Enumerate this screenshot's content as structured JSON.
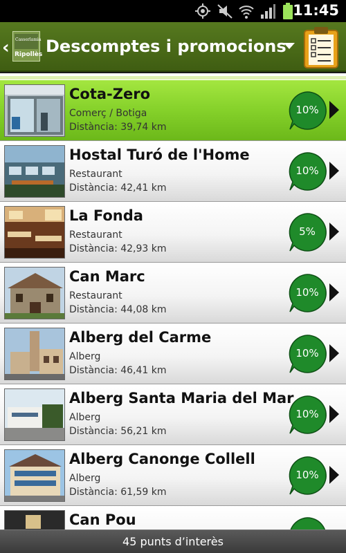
{
  "status_bar": {
    "time": "11:45",
    "icons": [
      "gps-icon",
      "mute-icon",
      "wifi-icon",
      "signal-icon",
      "battery-icon"
    ]
  },
  "action_bar": {
    "logo_text": "Ripollès",
    "logo_mini": "Casserlamia",
    "title": "Descomptes i promocions"
  },
  "items": [
    {
      "name": "Cota-Zero",
      "category": "Comerç / Botiga",
      "distance": "Distància: 39,74 km",
      "discount": "10%",
      "selected": true
    },
    {
      "name": "Hostal Turó de l'Home",
      "category": "Restaurant",
      "distance": "Distància: 42,41 km",
      "discount": "10%"
    },
    {
      "name": "La Fonda",
      "category": "Restaurant",
      "distance": "Distància: 42,93 km",
      "discount": "5%"
    },
    {
      "name": "Can Marc",
      "category": "Restaurant",
      "distance": "Distància: 44,08 km",
      "discount": "10%"
    },
    {
      "name": "Alberg del Carme",
      "category": "Alberg",
      "distance": "Distància: 46,41 km",
      "discount": "10%"
    },
    {
      "name": "Alberg Santa Maria del Mar",
      "category": "Alberg",
      "distance": "Distància: 56,21 km",
      "discount": "10%"
    },
    {
      "name": "Alberg Canonge Collell",
      "category": "Alberg",
      "distance": "Distància: 61,59 km",
      "discount": "10%"
    },
    {
      "name": "Can Pou",
      "category": "",
      "distance": "",
      "discount": ""
    }
  ],
  "footer": {
    "text": "45 punts d’interès"
  },
  "colors": {
    "action_bar": "#4a6a18",
    "selected_row": "#8ed630",
    "badge": "#1f8a2a"
  }
}
